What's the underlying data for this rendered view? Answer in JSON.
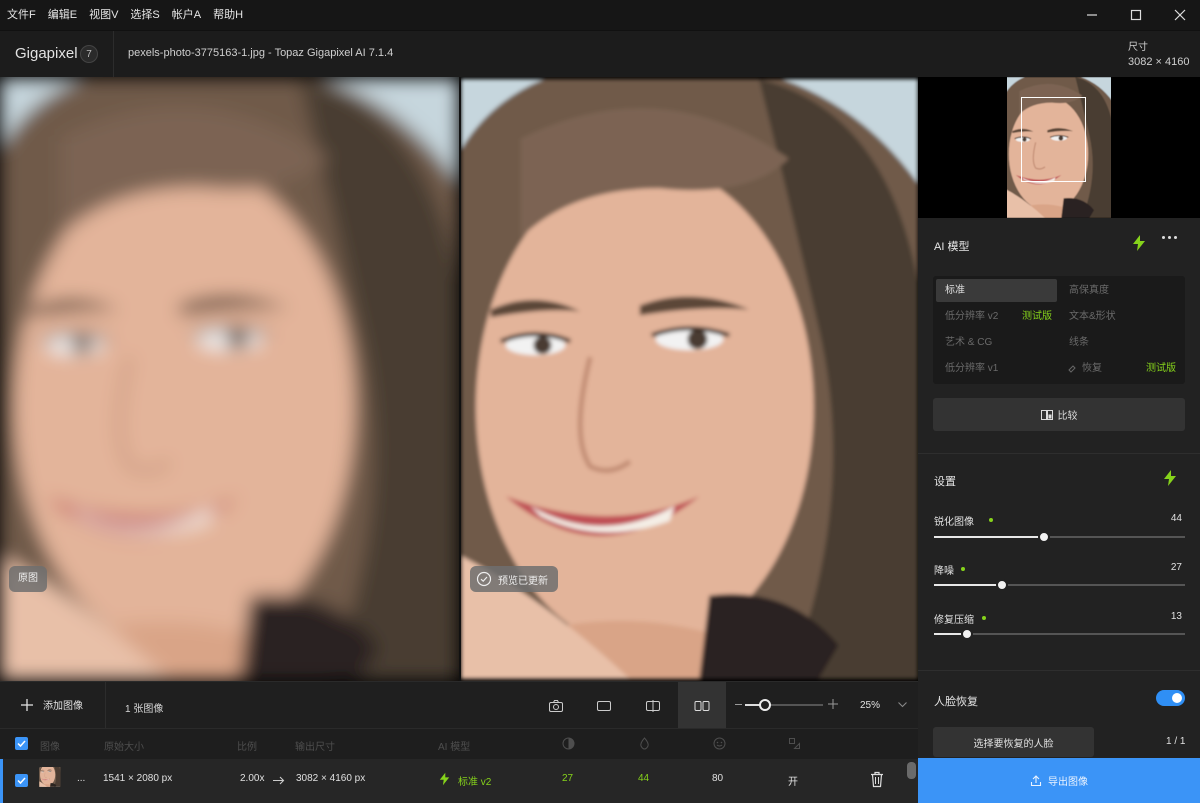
{
  "menu": [
    "文件F",
    "编辑E",
    "视图V",
    "选择S",
    "帐户A",
    "帮助H"
  ],
  "header": {
    "app_name": "Gigapixel",
    "version_badge": "7",
    "file_title": "pexels-photo-3775163-1.jpg - Topaz Gigapixel AI 7.1.4",
    "size_label": "尺寸",
    "size_value": "3082 × 4160"
  },
  "preview": {
    "original_badge": "原图",
    "updated_badge": "预览已更新"
  },
  "ai_model": {
    "title": "AI 模型",
    "beta_label": "测试版",
    "options": [
      {
        "label": "标准",
        "selected": true,
        "beta": false
      },
      {
        "label": "高保真度",
        "selected": false,
        "beta": false
      },
      {
        "label": "低分辨率 v2",
        "selected": false,
        "beta": true
      },
      {
        "label": "文本&形状",
        "selected": false,
        "beta": false
      },
      {
        "label": "艺术 & CG",
        "selected": false,
        "beta": false
      },
      {
        "label": "线条",
        "selected": false,
        "beta": false
      },
      {
        "label": "低分辨率 v1",
        "selected": false,
        "beta": false
      },
      {
        "label": "恢复",
        "selected": false,
        "beta": true
      }
    ],
    "compare_label": "比较"
  },
  "settings": {
    "title": "设置",
    "sliders": [
      {
        "label": "锐化图像",
        "value": 44
      },
      {
        "label": "降噪",
        "value": 27
      },
      {
        "label": "修复压缩",
        "value": 13
      }
    ]
  },
  "face_recovery": {
    "title": "人脸恢复",
    "enabled": true,
    "select_label": "选择要恢复的人脸",
    "count": "1 / 1"
  },
  "export_label": "导出图像",
  "toolbar": {
    "add_label": "添加图像",
    "image_count": "1 张图像",
    "zoom_percent": "25%",
    "zoom_level": 0.25
  },
  "table": {
    "headers": {
      "image": "图像",
      "original_size": "原始大小",
      "scale": "比例",
      "output_size": "输出尺寸",
      "ai_model": "AI 模型"
    },
    "row": {
      "name": "...",
      "original_size": "1541 × 2080 px",
      "scale": "2.00x",
      "output_size": "3082 × 4160 px",
      "model": "标准 v2",
      "sharpen": "27",
      "denoise": "44",
      "face": "80",
      "restore": "开"
    }
  },
  "colors": {
    "accent_green": "#86d31b",
    "accent_blue": "#3b94f7"
  }
}
